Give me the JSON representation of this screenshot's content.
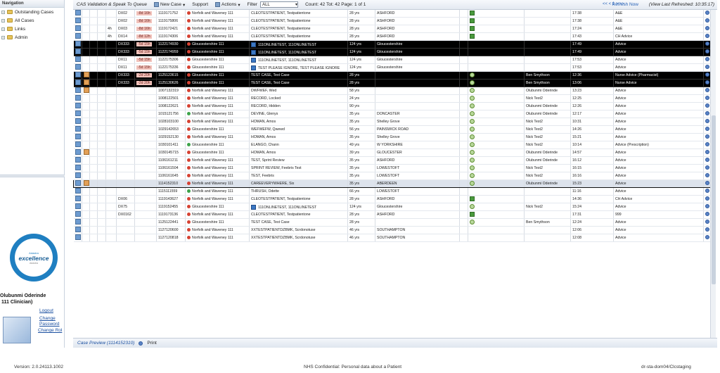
{
  "nav": {
    "heading": "Navigation",
    "items": [
      {
        "label": "Outstanding Cases"
      },
      {
        "label": "All Cases"
      },
      {
        "label": "Links"
      },
      {
        "label": "Admin"
      }
    ]
  },
  "logo": {
    "small": "Adastra",
    "main": "excellence",
    "sub": "Adastra"
  },
  "user": {
    "name": "Olubunmi Oderinde",
    "role": "111 Clinician)",
    "logout": "Logout",
    "change_password_1": "Change",
    "change_password_2": "Password",
    "change_role": "Change Rol"
  },
  "toolbar": {
    "cas": "CAS Validation & Speak To Queue",
    "new_case": "New Case",
    "support": "Support",
    "actions": "Actions",
    "filter_label": "Filter",
    "filter_value": "ALL",
    "count": "Count: 42 Tot: 42 Page: 1 of 1",
    "pager": "<< < 1 > >>",
    "refresh": "Refresh Now",
    "last_refreshed": "(View Last Refreshed: 10:35:17)"
  },
  "rows": [
    {
      "style": "",
      "warn": false,
      "alt": "",
      "code": "DX02",
      "tm": "-8d 16h",
      "caseno": "1119171752",
      "prov": "Norfolk and Waveney 111",
      "pdot": "red",
      "pat": "CLEOTESTPATIENT, Testpatientone",
      "picon": "",
      "age": "28 yrs",
      "loc": "ASHFORD",
      "stat": "grn",
      "clin": "",
      "time": "17:38",
      "svc": "A&E"
    },
    {
      "style": "",
      "warn": false,
      "alt": "",
      "code": "DX02",
      "tm": "-8d 16h",
      "caseno": "1119175806",
      "prov": "Norfolk and Waveney 111",
      "pdot": "red",
      "pat": "CLEOTESTPATIENT, Testpatientone",
      "picon": "",
      "age": "28 yrs",
      "loc": "ASHFORD",
      "stat": "grn",
      "clin": "",
      "time": "17:38",
      "svc": "A&E"
    },
    {
      "style": "",
      "warn": false,
      "alt": "4h",
      "code": "DX03",
      "tm": "-8d 16h",
      "caseno": "1119172421",
      "prov": "Norfolk and Waveney 111",
      "pdot": "red",
      "pat": "CLEOTESTPATIENT, Testpatientone",
      "picon": "",
      "age": "28 yrs",
      "loc": "ASHFORD",
      "stat": "grn",
      "clin": "",
      "time": "17:24",
      "svc": "A&E"
    },
    {
      "style": "",
      "warn": false,
      "alt": "4h",
      "code": "DX14",
      "tm": "-8d 12h",
      "caseno": "1119174306",
      "prov": "Norfolk and Waveney 111",
      "pdot": "red",
      "pat": "CLEOTESTPATIENT, Testpatientone",
      "picon": "",
      "age": "28 yrs",
      "loc": "ASHFORD",
      "stat": "grn",
      "clin": "",
      "time": "17:43",
      "svc": "CH Advice"
    },
    {
      "style": "black",
      "warn": false,
      "alt": "",
      "code": "DX333",
      "tm": "-5d 15h",
      "caseno": "1122174930",
      "prov": "Gloucestershire 111",
      "pdot": "red",
      "pat": "111ONLINETEST, 111ONLINETEST",
      "picon": "blu",
      "age": "124 yrs",
      "loc": "Gloucestershire",
      "stat": "",
      "clin": "",
      "time": "17:49",
      "svc": "Advice"
    },
    {
      "style": "black",
      "warn": false,
      "alt": "",
      "code": "DX333",
      "tm": "-5d 15h",
      "caseno": "1122174959",
      "prov": "Gloucestershire 111",
      "pdot": "red",
      "pat": "111ONLINETEST, 111ONLINETEST",
      "picon": "blu",
      "age": "124 yrs",
      "loc": "Gloucestershire",
      "stat": "",
      "clin": "",
      "time": "17:49",
      "svc": "Advice"
    },
    {
      "style": "",
      "warn": false,
      "alt": "",
      "code": "DX11",
      "tm": "-5d 15h",
      "caseno": "1122175306",
      "prov": "Gloucestershire 111",
      "pdot": "red",
      "pat": "111ONLINETEST, 111ONLINETEST",
      "picon": "blu",
      "age": "124 yrs",
      "loc": "Gloucestershire",
      "stat": "",
      "clin": "",
      "time": "17:53",
      "svc": "Advice"
    },
    {
      "style": "",
      "warn": false,
      "alt": "",
      "code": "DX11",
      "tm": "-5d 15h",
      "caseno": "1122175336",
      "prov": "Gloucestershire 111",
      "pdot": "red",
      "pat": "TEST PLEASE IGNORE, TEST PLEASE IGNORE",
      "picon": "blu",
      "age": "124 yrs",
      "loc": "Gloucestershire",
      "stat": "",
      "clin": "",
      "time": "17:53",
      "svc": "Advice"
    },
    {
      "style": "black",
      "warn": true,
      "alt": "",
      "code": "DX333",
      "tm": "-2d 20h",
      "caseno": "1125123615",
      "prov": "Gloucestershire 111",
      "pdot": "red",
      "pat": "TEST CASE, Test Case",
      "picon": "",
      "age": "28 yrs",
      "loc": "",
      "stat": "chk",
      "clin": "Ben Smythson",
      "time": "12:36",
      "svc": "Nurse Advice (Pharmacist)"
    },
    {
      "style": "black",
      "warn": true,
      "alt": "",
      "code": "DX333",
      "tm": "-2d 20h",
      "caseno": "1125130626",
      "prov": "Gloucestershire 111",
      "pdot": "red",
      "pat": "TEST CASE, Test Case",
      "picon": "",
      "age": "28 yrs",
      "loc": "",
      "stat": "chk",
      "clin": "Ben Smythson",
      "time": "13:06",
      "svc": "Nurse Advice"
    },
    {
      "style": "",
      "warn": true,
      "alt": "",
      "code": "",
      "tm": "",
      "caseno": "1007132319",
      "prov": "Norfolk and Waveney 111",
      "pdot": "red",
      "pat": "DWFWEF, Wed",
      "picon": "",
      "age": "58 yrs",
      "loc": "",
      "stat": "chk",
      "clin": "Olubunmi Oderinde",
      "time": "13:23",
      "svc": "Advice"
    },
    {
      "style": "",
      "warn": false,
      "alt": "",
      "code": "",
      "tm": "",
      "caseno": "1008122501",
      "prov": "Norfolk and Waveney 111",
      "pdot": "red",
      "pat": "RECORD, Locked",
      "picon": "",
      "age": "24 yrs",
      "loc": "",
      "stat": "chk",
      "clin": "Nick Test2",
      "time": "12:25",
      "svc": "Advice"
    },
    {
      "style": "",
      "warn": false,
      "alt": "",
      "code": "",
      "tm": "",
      "caseno": "1008122621",
      "prov": "Norfolk and Waveney 111",
      "pdot": "red",
      "pat": "RECORD, Hidden",
      "picon": "",
      "age": "90 yrs",
      "loc": "",
      "stat": "chk",
      "clin": "Olubunmi Oderinde",
      "time": "12:26",
      "svc": "Advice"
    },
    {
      "style": "",
      "warn": false,
      "alt": "",
      "code": "",
      "tm": "",
      "caseno": "1015121756",
      "prov": "Norfolk and Waveney 111",
      "pdot": "green",
      "pat": "DEVINE, Glenys",
      "picon": "",
      "age": "35 yrs",
      "loc": "DONCASTER",
      "stat": "chk",
      "clin": "Olubunmi Oderinde",
      "time": "12:17",
      "svc": "Advice"
    },
    {
      "style": "",
      "warn": false,
      "alt": "",
      "code": "",
      "tm": "",
      "caseno": "1028103100",
      "prov": "Norfolk and Waveney 111",
      "pdot": "red",
      "pat": "HOMAN, Amos",
      "picon": "",
      "age": "35 yrs",
      "loc": "Shelley Grove",
      "stat": "chk",
      "clin": "Nick Test2",
      "time": "10:31",
      "svc": "Advice"
    },
    {
      "style": "",
      "warn": false,
      "alt": "",
      "code": "",
      "tm": "",
      "caseno": "1029142653",
      "prov": "Gloucestershire 111",
      "pdot": "red",
      "pat": "WEFWEFW, Qwewd",
      "picon": "",
      "age": "56 yrs",
      "loc": "PAINSWICK ROAD",
      "stat": "chk",
      "clin": "Nick Test2",
      "time": "14:26",
      "svc": "Advice"
    },
    {
      "style": "",
      "warn": false,
      "alt": "",
      "code": "",
      "tm": "",
      "caseno": "1029152130",
      "prov": "Norfolk and Waveney 111",
      "pdot": "red",
      "pat": "HOMAN, Amos",
      "picon": "",
      "age": "35 yrs",
      "loc": "Shelley Grove",
      "stat": "chk",
      "clin": "Nick Test2",
      "time": "15:21",
      "svc": "Advice"
    },
    {
      "style": "",
      "warn": false,
      "alt": "",
      "code": "",
      "tm": "",
      "caseno": "1030101411",
      "prov": "Gloucestershire 111",
      "pdot": "green",
      "pat": "ELANGO, Chann",
      "picon": "",
      "age": "49 yrs",
      "loc": "W YORKSHIRE",
      "stat": "chk",
      "clin": "Nick Test2",
      "time": "10:14",
      "svc": "Advice (Prescription)"
    },
    {
      "style": "",
      "warn": true,
      "alt": "",
      "code": "",
      "tm": "",
      "caseno": "1030145715",
      "prov": "Gloucestershire 111",
      "pdot": "red",
      "pat": "HOMAN, Amos",
      "picon": "",
      "age": "39 yrs",
      "loc": "GLOUCESTER",
      "stat": "chk",
      "clin": "Olubunmi Oderinde",
      "time": "14:57",
      "svc": "Advice"
    },
    {
      "style": "",
      "warn": false,
      "alt": "",
      "code": "",
      "tm": "",
      "caseno": "1106161211",
      "prov": "Norfolk and Waveney 111",
      "pdot": "red",
      "pat": "TEST, Sprint Review",
      "picon": "",
      "age": "35 yrs",
      "loc": "ASHFORD",
      "stat": "chk",
      "clin": "Olubunmi Oderinde",
      "time": "16:12",
      "svc": "Advice"
    },
    {
      "style": "",
      "warn": false,
      "alt": "",
      "code": "",
      "tm": "",
      "caseno": "1106161504",
      "prov": "Norfolk and Waveney 111",
      "pdot": "red",
      "pat": "SPRINT REVIEW, Feebris Test",
      "picon": "",
      "age": "35 yrs",
      "loc": "LOWESTOFT",
      "stat": "chk",
      "clin": "Nick Test2",
      "time": "16:15",
      "svc": "Advice"
    },
    {
      "style": "",
      "warn": false,
      "alt": "",
      "code": "",
      "tm": "",
      "caseno": "1106161645",
      "prov": "Norfolk and Waveney 111",
      "pdot": "red",
      "pat": "TEST, Feebris",
      "picon": "",
      "age": "35 yrs",
      "loc": "LOWESTOFT",
      "stat": "chk",
      "clin": "Nick Test2",
      "time": "16:16",
      "svc": "Advice"
    },
    {
      "style": "selrow",
      "warn": true,
      "alt": "",
      "code": "",
      "tm": "",
      "caseno": "1114152310",
      "prov": "Norfolk and Waveney 111",
      "pdot": "red",
      "pat": "CAREEVERYWHERE, Six",
      "picon": "",
      "age": "35 yrs",
      "loc": "ABERDEEN",
      "stat": "chk",
      "clin": "Olubunmi Oderinde",
      "time": "15:23",
      "svc": "Advice"
    },
    {
      "style": "",
      "warn": false,
      "alt": "",
      "code": "",
      "tm": "",
      "caseno": "1115111559",
      "prov": "Norfolk and Waveney 111",
      "pdot": "green",
      "pat": "THRUSH, Odette",
      "picon": "",
      "age": "66 yrs",
      "loc": "LOWESTOFT",
      "stat": "",
      "clin": "",
      "time": "11:16",
      "svc": "Advice"
    },
    {
      "style": "",
      "warn": false,
      "alt": "",
      "code": "DX06",
      "tm": "",
      "caseno": "1119143627",
      "prov": "Norfolk and Waveney 111",
      "pdot": "red",
      "pat": "CLEOTESTPATIENT, Testpatientone",
      "picon": "",
      "age": "28 yrs",
      "loc": "ASHFORD",
      "stat": "grn",
      "clin": "",
      "time": "14:36",
      "svc": "CH Advice"
    },
    {
      "style": "",
      "warn": false,
      "alt": "",
      "code": "DX75",
      "tm": "",
      "caseno": "1119152455",
      "prov": "Gloucestershire 111",
      "pdot": "red",
      "pat": "111ONLINETEST, 111ONLINETEST",
      "picon": "blu",
      "age": "124 yrs",
      "loc": "Gloucestershire",
      "stat": "chk",
      "clin": "Nick Test2",
      "time": "15:24",
      "svc": "Advice"
    },
    {
      "style": "",
      "warn": false,
      "alt": "",
      "code": "DX0162",
      "tm": "",
      "caseno": "1119173136",
      "prov": "Norfolk and Waveney 111",
      "pdot": "red",
      "pat": "CLEOTESTPATIENT, Testpatientone",
      "picon": "",
      "age": "28 yrs",
      "loc": "ASHFORD",
      "stat": "grn",
      "clin": "",
      "time": "17:31",
      "svc": "999"
    },
    {
      "style": "",
      "warn": false,
      "alt": "",
      "code": "",
      "tm": "",
      "caseno": "1125122441",
      "prov": "Gloucestershire 111",
      "pdot": "red",
      "pat": "TEST CASE, Test Case",
      "picon": "",
      "age": "28 yrs",
      "loc": "",
      "stat": "chk",
      "clin": "Ben Smythson",
      "time": "12:24",
      "svc": "Advice"
    },
    {
      "style": "",
      "warn": false,
      "alt": "",
      "code": "",
      "tm": "",
      "caseno": "1127120600",
      "prov": "Norfolk and Waveney 111",
      "pdot": "red",
      "pat": "XXTESTPATIENTDZBMK, Scrdonotuse",
      "picon": "",
      "age": "46 yrs",
      "loc": "SOUTHAMPTON",
      "stat": "",
      "clin": "",
      "time": "12:06",
      "svc": "Advice"
    },
    {
      "style": "",
      "warn": false,
      "alt": "",
      "code": "",
      "tm": "",
      "caseno": "1127120818",
      "prov": "Norfolk and Waveney 111",
      "pdot": "red",
      "pat": "XXTESTPATIENTDZBMK, Scrdonotuse",
      "picon": "",
      "age": "46 yrs",
      "loc": "SOUTHAMPTON",
      "stat": "",
      "clin": "",
      "time": "12:08",
      "svc": "Advice"
    }
  ],
  "preview": {
    "title": "Case Preview (1114152310)",
    "print": "Print"
  },
  "footer": {
    "version": "Version: 2.0.24113.1002",
    "confidential": "NHS Confidential: Personal data about a Patient",
    "server": "dr-sta-dom04/Clcstaging"
  },
  "colors": {
    "accent": "#1f7fc1",
    "selected_border": "#111111",
    "highlight_row": "#000000",
    "time_badge": "#f2c3bc"
  }
}
